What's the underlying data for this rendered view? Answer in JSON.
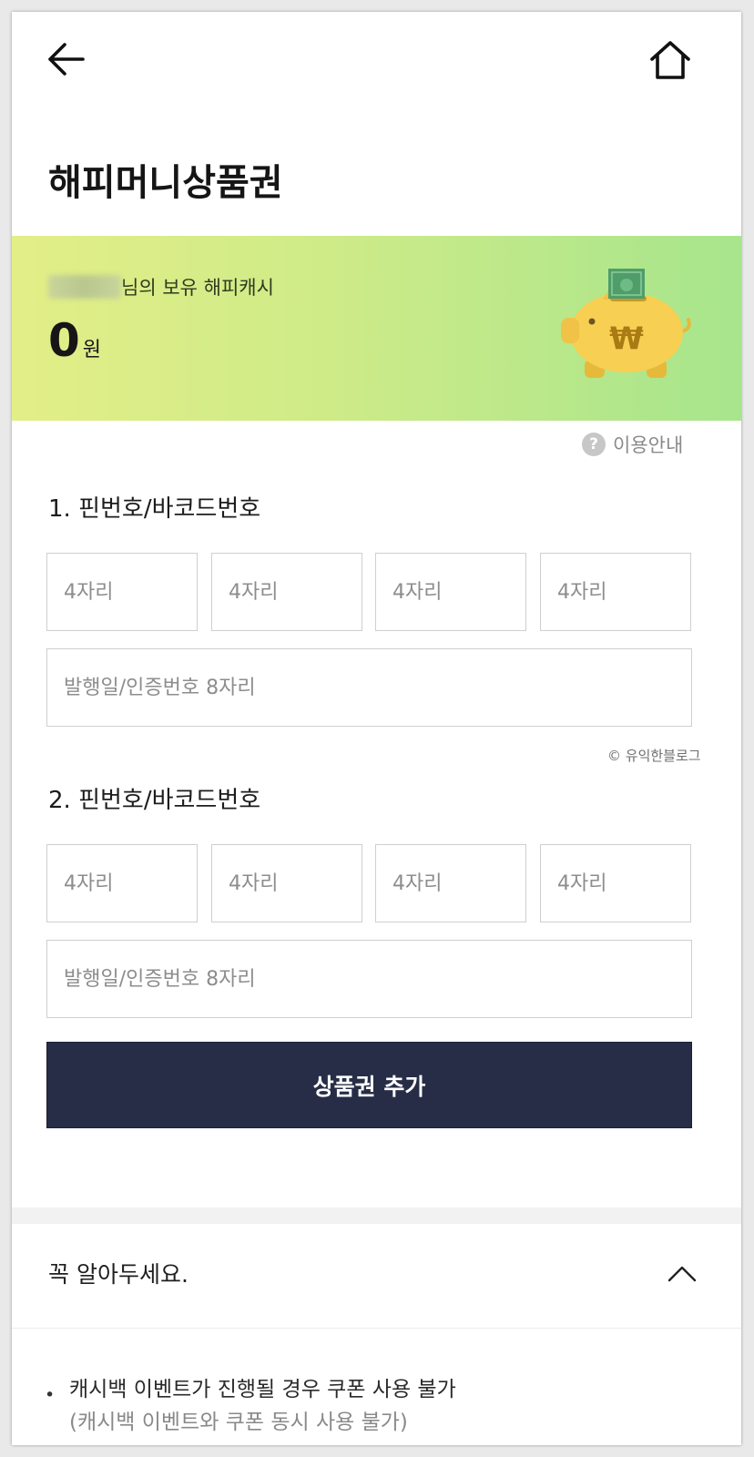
{
  "header": {
    "back_icon": "arrow-left-icon",
    "home_icon": "home-icon",
    "title": "해피머니상품권"
  },
  "balance": {
    "owner_suffix": "님의 보유 해피캐시",
    "amount": "0",
    "unit": "원",
    "illustration": "piggy-bank-icon"
  },
  "help": {
    "icon": "question-circle-icon",
    "label": "이용안내"
  },
  "sections": [
    {
      "label": "1. 핀번호/바코드번호",
      "pin_placeholders": [
        "4자리",
        "4자리",
        "4자리",
        "4자리"
      ],
      "pin_values": [
        "",
        "",
        "",
        ""
      ],
      "auth_placeholder": "발행일/인증번호 8자리",
      "auth_value": ""
    },
    {
      "label": "2. 핀번호/바코드번호",
      "pin_placeholders": [
        "4자리",
        "4자리",
        "4자리",
        "4자리"
      ],
      "pin_values": [
        "",
        "",
        "",
        ""
      ],
      "auth_placeholder": "발행일/인증번호 8자리",
      "auth_value": ""
    }
  ],
  "watermark": "© 유익한블로그",
  "add_button": "상품권 추가",
  "notice": {
    "title": "꼭 알아두세요.",
    "toggle_icon": "chevron-up-icon",
    "bullet": "•",
    "items": [
      "캐시백 이벤트가 진행될 경우 쿠폰 사용 불가",
      "(캐시백 이벤트와 쿠폰 동시 사용 불가)"
    ]
  },
  "colors": {
    "button_bg": "#272d46",
    "banner_start": "#e3ee87",
    "banner_end": "#a7e58c",
    "piggy_body": "#f7cf52",
    "cash_green": "#4f9e6a"
  }
}
